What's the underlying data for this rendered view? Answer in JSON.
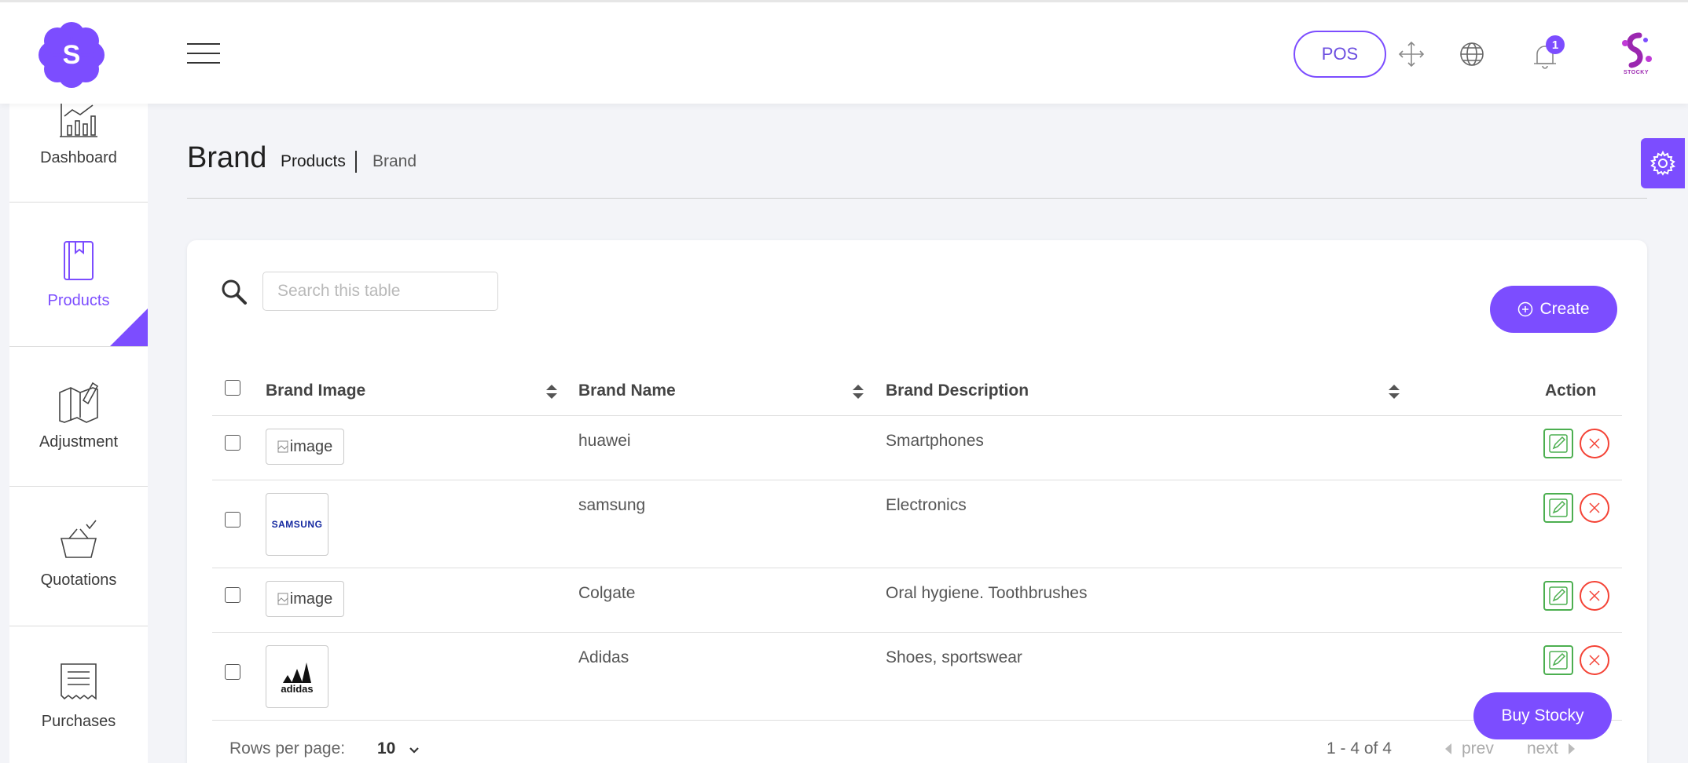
{
  "header": {
    "logo_letter": "S",
    "pos_label": "POS",
    "notification_count": "1",
    "brand_mark_text": "STOCKY"
  },
  "sidebar": {
    "items": [
      {
        "label": "Dashboard",
        "icon": "dashboard-chart-icon"
      },
      {
        "label": "Products",
        "icon": "book-icon",
        "active": true
      },
      {
        "label": "Adjustment",
        "icon": "map-pencil-icon"
      },
      {
        "label": "Quotations",
        "icon": "basket-check-icon"
      },
      {
        "label": "Purchases",
        "icon": "receipt-icon"
      }
    ]
  },
  "page": {
    "title": "Brand",
    "breadcrumb": [
      "Products",
      "Brand"
    ]
  },
  "search": {
    "placeholder": "Search this table"
  },
  "create_label": "Create",
  "table": {
    "columns": [
      "Brand Image",
      "Brand Name",
      "Brand Description",
      "Action"
    ],
    "rows": [
      {
        "image": "image",
        "name": "huawei",
        "description": "Smartphones"
      },
      {
        "image": "SAMSUNG",
        "name": "samsung",
        "description": "Electronics"
      },
      {
        "image": "image",
        "name": "Colgate",
        "description": "Oral hygiene. Toothbrushes"
      },
      {
        "image": "adidas",
        "name": "Adidas",
        "description": "Shoes, sportswear"
      }
    ]
  },
  "pagination": {
    "rows_per_page_label": "Rows per page:",
    "rows_per_page_value": "10",
    "range": "1 - 4 of 4",
    "prev": "prev",
    "next": "next"
  },
  "buy_label": "Buy Stocky",
  "colors": {
    "accent": "#7c4dff",
    "edit": "#4caf50",
    "delete": "#f44336"
  }
}
